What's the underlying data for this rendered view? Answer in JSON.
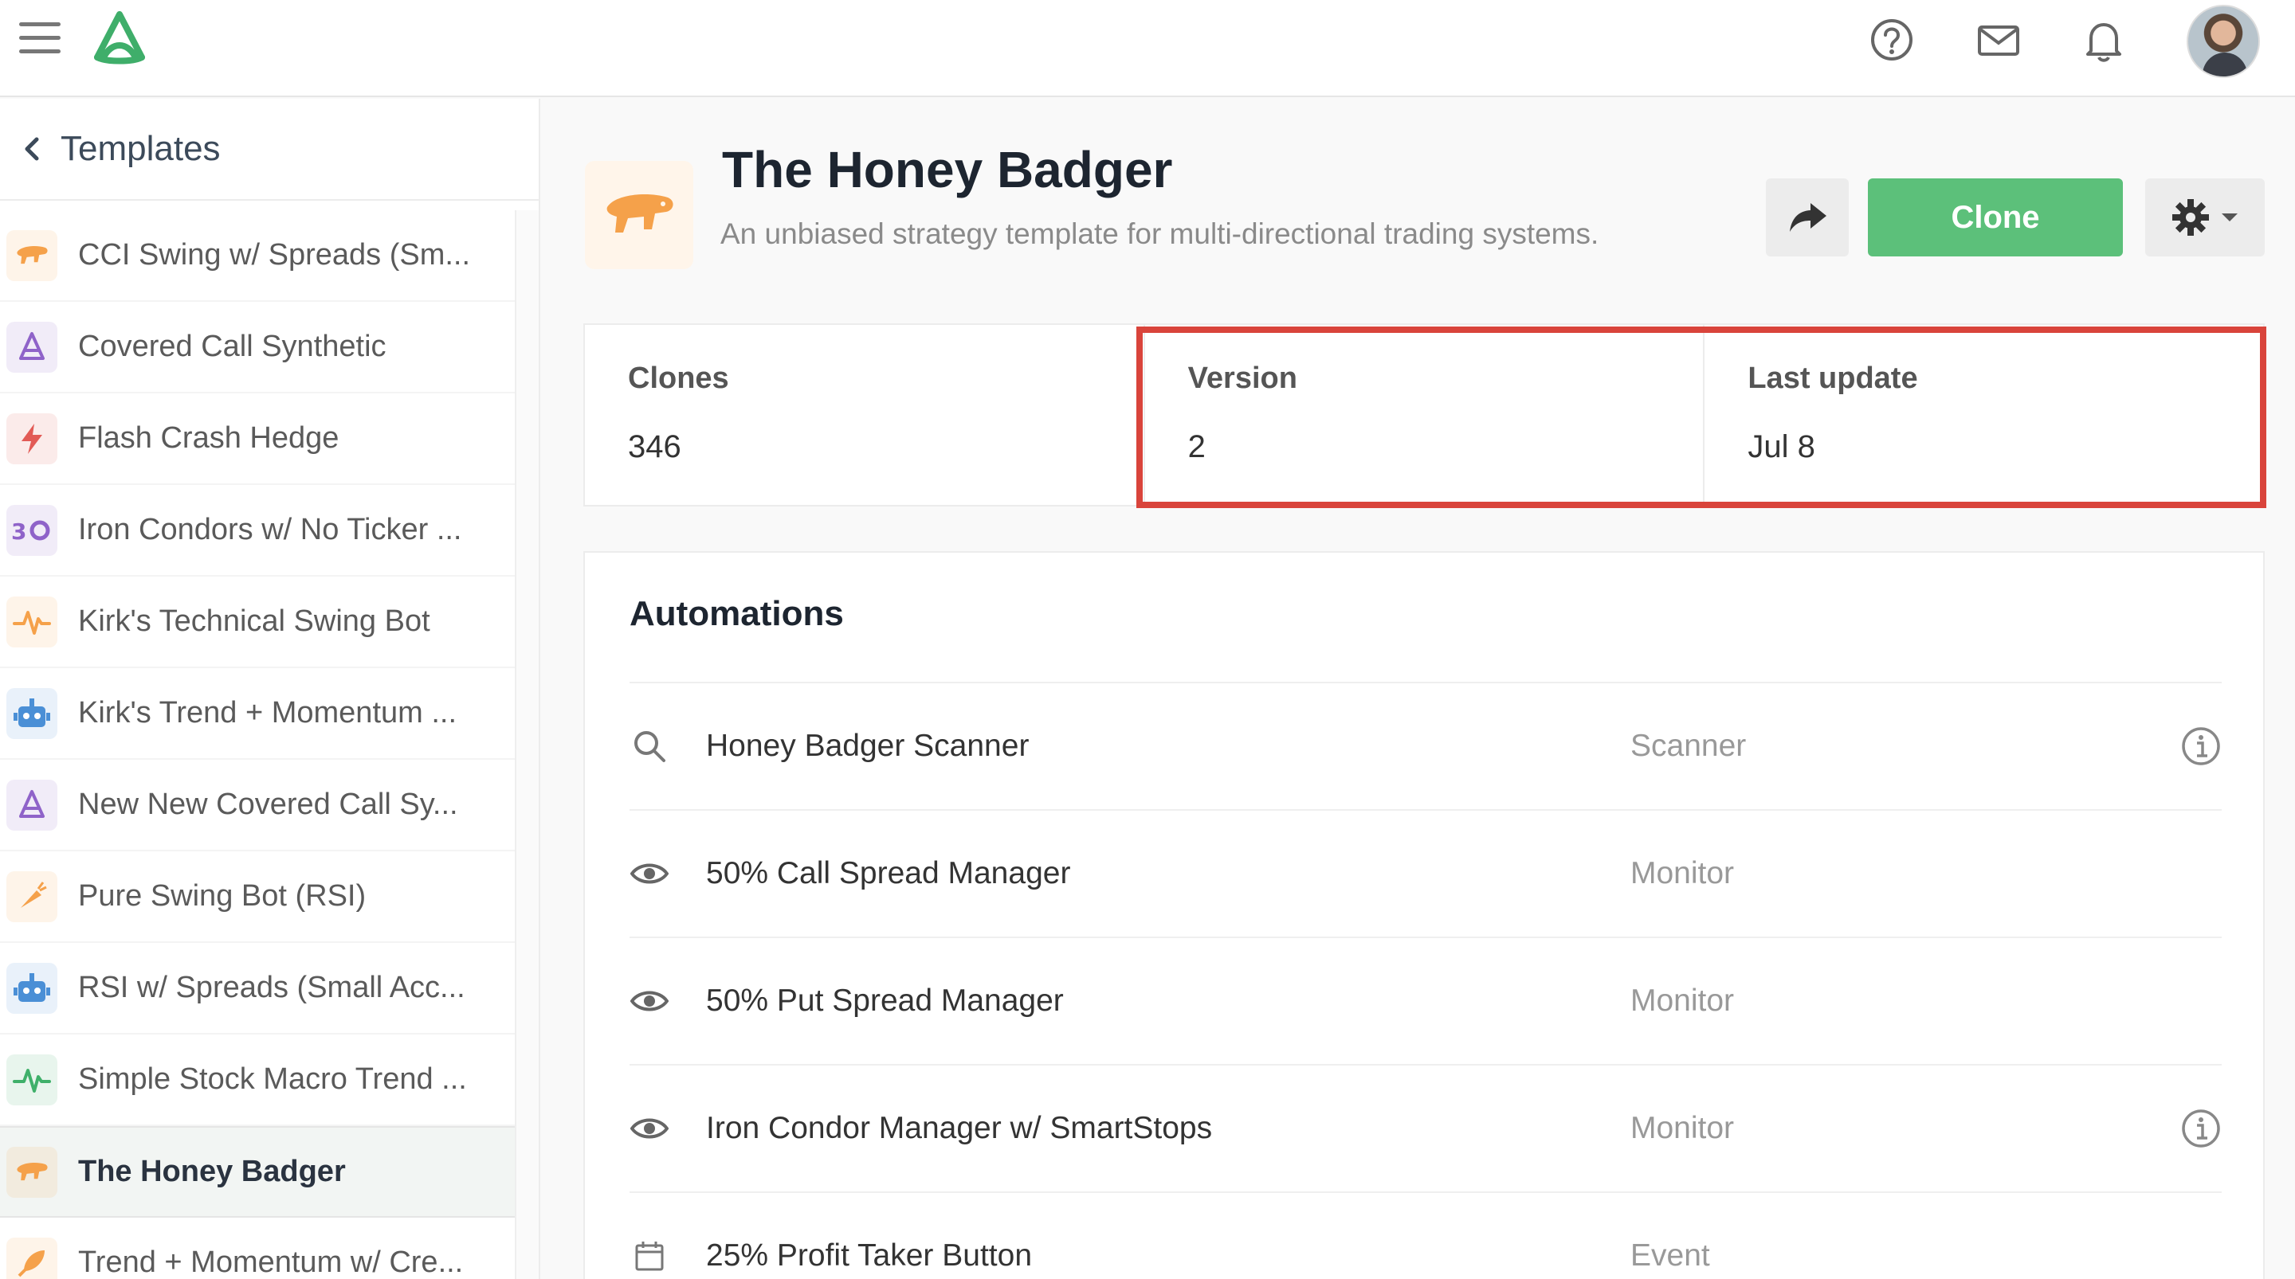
{
  "topbar": {
    "icons": [
      "menu-icon",
      "logo-icon",
      "help-icon",
      "mail-icon",
      "bell-icon",
      "avatar"
    ]
  },
  "sidebar": {
    "back_label": "Templates",
    "items": [
      {
        "label": "CCI Swing w/ Spreads (Sm...",
        "icon": "badger-icon",
        "color": "#f5a14a"
      },
      {
        "label": "Covered Call Synthetic",
        "icon": "wizard-icon",
        "color": "#8f63c9"
      },
      {
        "label": "Flash Crash Hedge",
        "icon": "lightning-icon",
        "color": "#e25a55"
      },
      {
        "label": "Iron Condors w/ No Ticker ...",
        "icon": "condor-icon",
        "color": "#8f63c9"
      },
      {
        "label": "Kirk's Technical Swing Bot",
        "icon": "pulse-icon",
        "color": "#f5a14a"
      },
      {
        "label": "Kirk's Trend + Momentum ...",
        "icon": "robot-icon",
        "color": "#4a8fd6"
      },
      {
        "label": "New New Covered Call Sy...",
        "icon": "wizard-icon",
        "color": "#8f63c9"
      },
      {
        "label": "Pure Swing Bot (RSI)",
        "icon": "carrot-icon",
        "color": "#f5a14a"
      },
      {
        "label": "RSI w/ Spreads (Small Acc...",
        "icon": "robot-icon",
        "color": "#4a8fd6"
      },
      {
        "label": "Simple Stock Macro Trend ...",
        "icon": "pulse-icon",
        "color": "#3fb06a"
      },
      {
        "label": "The Honey Badger",
        "icon": "badger-icon",
        "color": "#f5a14a",
        "active": true
      },
      {
        "label": "Trend + Momentum w/ Cre...",
        "icon": "rocket-icon",
        "color": "#f5a14a"
      }
    ]
  },
  "header": {
    "title": "The Honey Badger",
    "subtitle": "An unbiased strategy template for multi-directional trading systems.",
    "clone_label": "Clone",
    "icon": "badger-icon"
  },
  "stats": {
    "clones_label": "Clones",
    "clones_value": "346",
    "version_label": "Version",
    "version_value": "2",
    "updated_label": "Last update",
    "updated_value": "Jul 8"
  },
  "automations": {
    "title": "Automations",
    "rows": [
      {
        "name": "Honey Badger Scanner",
        "type": "Scanner",
        "icon": "search-icon",
        "info": true
      },
      {
        "name": "50% Call Spread Manager",
        "type": "Monitor",
        "icon": "eye-icon",
        "info": false
      },
      {
        "name": "50% Put Spread Manager",
        "type": "Monitor",
        "icon": "eye-icon",
        "info": false
      },
      {
        "name": "Iron Condor Manager w/ SmartStops",
        "type": "Monitor",
        "icon": "eye-icon",
        "info": true
      },
      {
        "name": "25% Profit Taker Button",
        "type": "Event",
        "icon": "calendar-icon",
        "info": false
      }
    ]
  },
  "colors": {
    "accent": "#5cc07a",
    "highlight": "#d9443b"
  }
}
